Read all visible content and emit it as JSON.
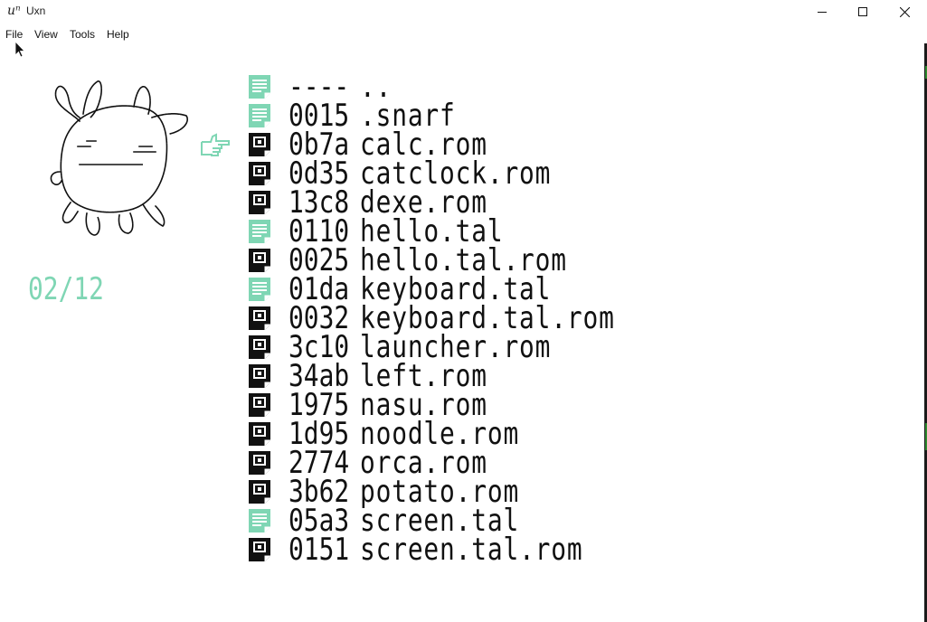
{
  "window": {
    "title": "Uxn",
    "app_icon": "uxn-logo"
  },
  "window_controls": {
    "minimize_icon": "minimize-icon",
    "maximize_icon": "maximize-icon",
    "close_icon": "close-icon"
  },
  "menu": [
    "File",
    "View",
    "Tools",
    "Help"
  ],
  "launcher": {
    "counter": "02/12",
    "selected_index": 2,
    "accent_color": "#7fd6b4",
    "files": [
      {
        "size": "----",
        "name": "..",
        "kind": "text"
      },
      {
        "size": "0015",
        "name": ".snarf",
        "kind": "text"
      },
      {
        "size": "0b7a",
        "name": "calc.rom",
        "kind": "rom"
      },
      {
        "size": "0d35",
        "name": "catclock.rom",
        "kind": "rom"
      },
      {
        "size": "13c8",
        "name": "dexe.rom",
        "kind": "rom"
      },
      {
        "size": "0110",
        "name": "hello.tal",
        "kind": "text"
      },
      {
        "size": "0025",
        "name": "hello.tal.rom",
        "kind": "rom"
      },
      {
        "size": "01da",
        "name": "keyboard.tal",
        "kind": "text"
      },
      {
        "size": "0032",
        "name": "keyboard.tal.rom",
        "kind": "rom"
      },
      {
        "size": "3c10",
        "name": "launcher.rom",
        "kind": "rom"
      },
      {
        "size": "34ab",
        "name": "left.rom",
        "kind": "rom"
      },
      {
        "size": "1975",
        "name": "nasu.rom",
        "kind": "rom"
      },
      {
        "size": "1d95",
        "name": "noodle.rom",
        "kind": "rom"
      },
      {
        "size": "2774",
        "name": "orca.rom",
        "kind": "rom"
      },
      {
        "size": "3b62",
        "name": "potato.rom",
        "kind": "rom"
      },
      {
        "size": "05a3",
        "name": "screen.tal",
        "kind": "text"
      },
      {
        "size": "0151",
        "name": "screen.tal.rom",
        "kind": "rom"
      }
    ]
  }
}
